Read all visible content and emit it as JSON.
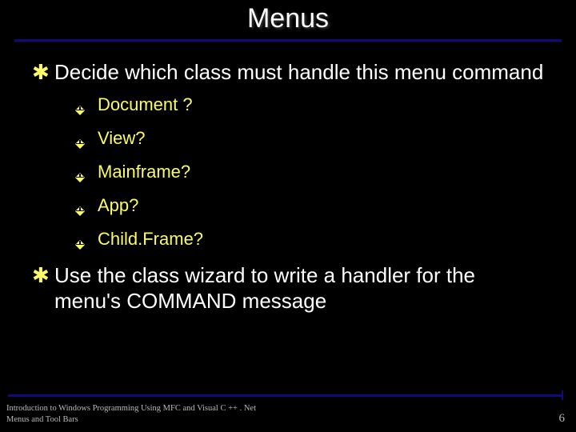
{
  "title": "Menus",
  "bullets": [
    {
      "text": "Decide which class must handle this menu command",
      "sub": [
        "Document ?",
        "View?",
        "Mainframe?",
        "App?",
        "Child.Frame?"
      ]
    },
    {
      "text": "Use the class wizard to write a handler for the menu's COMMAND message",
      "sub": []
    }
  ],
  "footer": {
    "line1": "Introduction to Windows Programming Using MFC and Visual C ++ . Net",
    "line2": "Menus and Tool Bars"
  },
  "page_number": "6"
}
